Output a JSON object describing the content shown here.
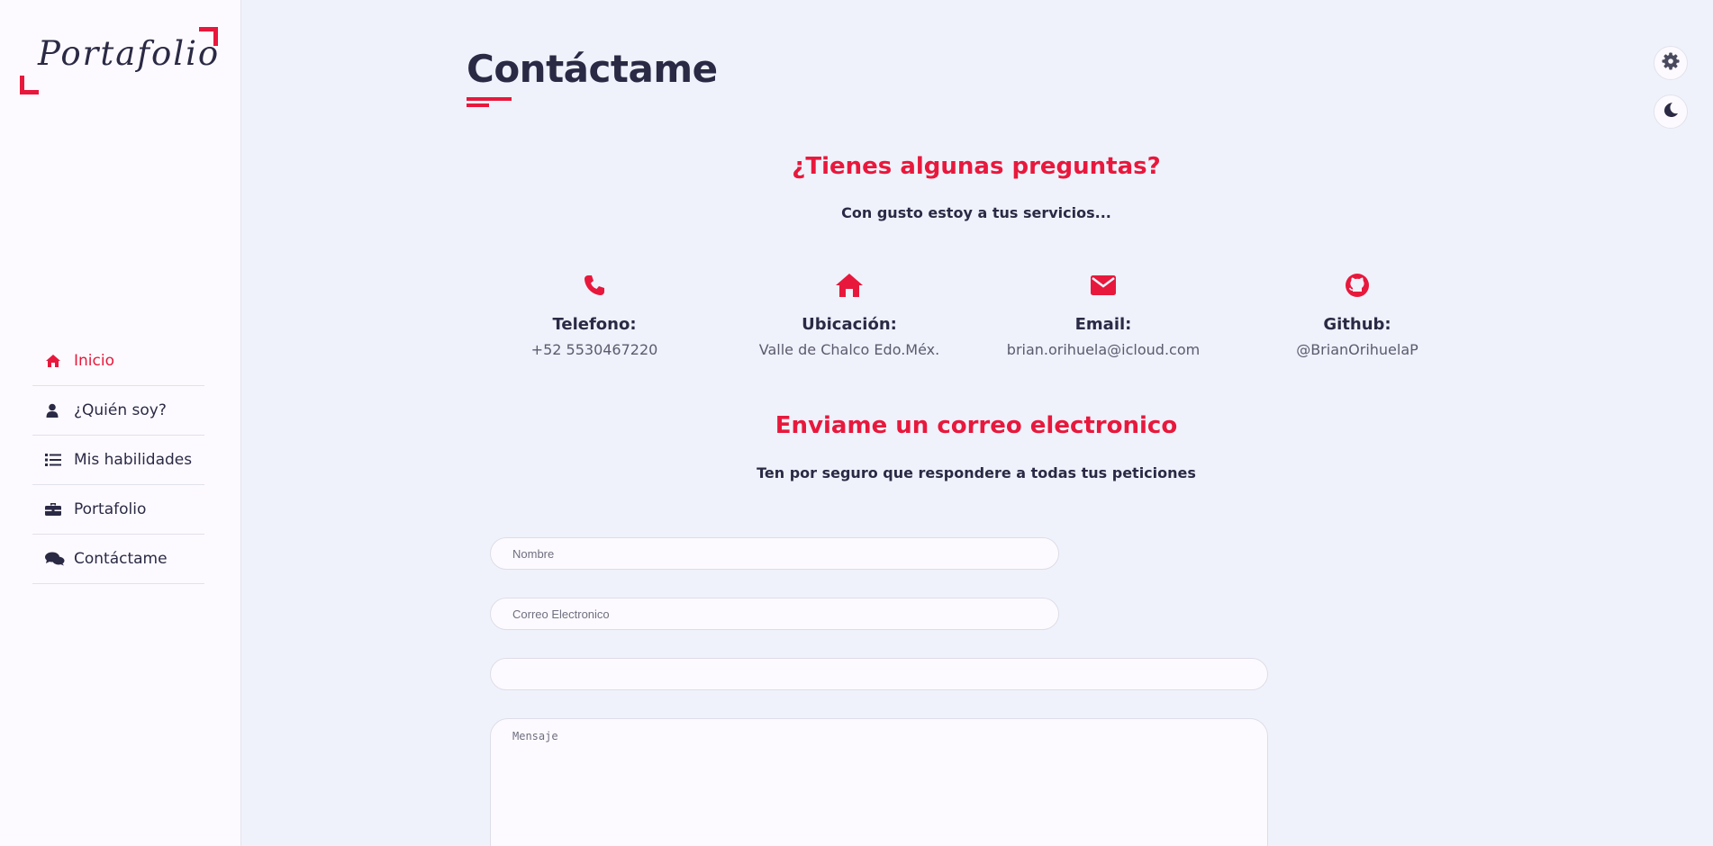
{
  "sidebar": {
    "logo_text": "Portafolio",
    "items": [
      {
        "label": "Inicio",
        "icon": "home-icon",
        "active": true
      },
      {
        "label": "¿Quién soy?",
        "icon": "user-icon",
        "active": false
      },
      {
        "label": "Mis habilidades",
        "icon": "list-icon",
        "active": false
      },
      {
        "label": "Portafolio",
        "icon": "briefcase-icon",
        "active": false
      },
      {
        "label": "Contáctame",
        "icon": "comments-icon",
        "active": false
      }
    ]
  },
  "main": {
    "title": "Contáctame",
    "questions_heading": "¿Tienes algunas preguntas?",
    "questions_sub": "Con gusto estoy a tus servicios...",
    "contacts": [
      {
        "icon": "phone-icon",
        "title": "Telefono:",
        "value": "+52 5530467220"
      },
      {
        "icon": "home-icon",
        "title": "Ubicación:",
        "value": "Valle de Chalco Edo.Méx."
      },
      {
        "icon": "envelope-icon",
        "title": "Email:",
        "value": "brian.orihuela@icloud.com"
      },
      {
        "icon": "github-icon",
        "title": "Github:",
        "value": "@BrianOrihuelaP"
      }
    ],
    "email_heading": "Enviame un correo electronico",
    "email_sub": "Ten por seguro que respondere a todas tus peticiones",
    "form": {
      "name_placeholder": "Nombre",
      "email_placeholder": "Correo Electronico",
      "subject_placeholder": "",
      "message_placeholder": "Mensaje"
    }
  },
  "controls": {
    "settings_icon": "gear-icon",
    "theme_icon": "moon-icon"
  },
  "colors": {
    "accent": "#e8183c",
    "text": "#2b2a45",
    "background": "#eff2fb",
    "sidebar": "#fdfaff"
  }
}
